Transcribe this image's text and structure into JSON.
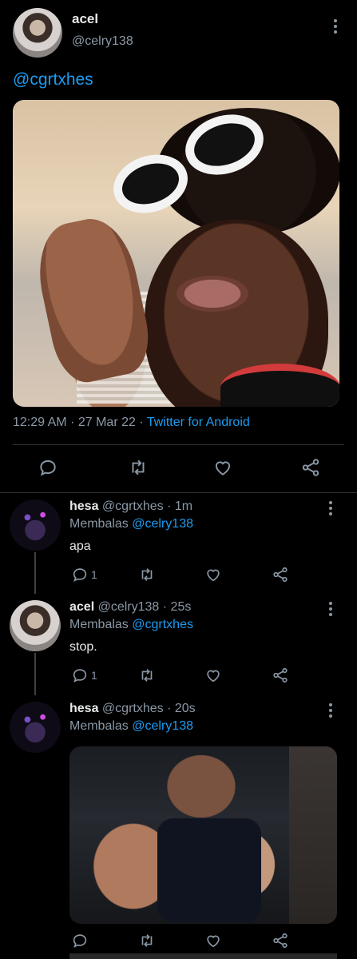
{
  "main_tweet": {
    "name": "acel",
    "handle": "@celry138",
    "text": "@cgrtxhes",
    "time": "12:29 AM",
    "sep1": "·",
    "date": "27 Mar 22",
    "sep2": "·",
    "source": "Twitter for Android"
  },
  "replies": [
    {
      "name": "hesa",
      "handle": "@cgrtxhes",
      "dot": "·",
      "age": "1m",
      "replying_prefix": "Membalas",
      "replying_to": "@celry138",
      "text": "apa",
      "reply_count": "1"
    },
    {
      "name": "acel",
      "handle": "@celry138",
      "dot": "·",
      "age": "25s",
      "replying_prefix": "Membalas",
      "replying_to": "@cgrtxhes",
      "text": "stop.",
      "reply_count": "1"
    },
    {
      "name": "hesa",
      "handle": "@cgrtxhes",
      "dot": "·",
      "age": "20s",
      "replying_prefix": "Membalas",
      "replying_to": "@celry138"
    }
  ],
  "icons": {
    "reply": "reply-icon",
    "retweet": "retweet-icon",
    "like": "heart-icon",
    "share": "share-icon",
    "more": "more-vertical-icon"
  },
  "colors": {
    "background": "#000000",
    "link": "#1d9bf0",
    "secondary_text": "#8b98a5",
    "divider": "#2f3336"
  }
}
